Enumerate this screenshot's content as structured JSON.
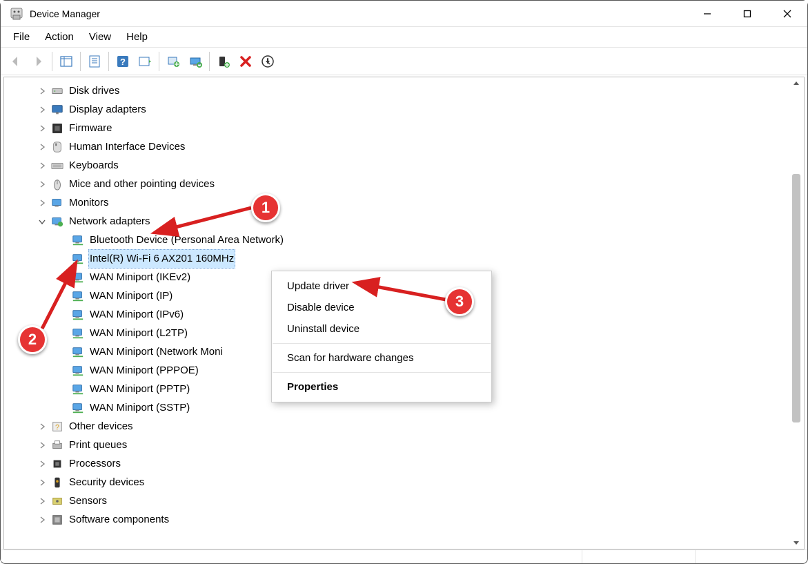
{
  "window": {
    "title": "Device Manager"
  },
  "menu": {
    "file": "File",
    "action": "Action",
    "view": "View",
    "help": "Help"
  },
  "tree": {
    "categories": [
      {
        "label": "Disk drives",
        "expanded": false,
        "iconType": "disk"
      },
      {
        "label": "Display adapters",
        "expanded": false,
        "iconType": "display"
      },
      {
        "label": "Firmware",
        "expanded": false,
        "iconType": "firmware"
      },
      {
        "label": "Human Interface Devices",
        "expanded": false,
        "iconType": "hid"
      },
      {
        "label": "Keyboards",
        "expanded": false,
        "iconType": "keyboard"
      },
      {
        "label": "Mice and other pointing devices",
        "expanded": false,
        "iconType": "mouse"
      },
      {
        "label": "Monitors",
        "expanded": false,
        "iconType": "monitor"
      },
      {
        "label": "Network adapters",
        "expanded": true,
        "iconType": "network",
        "children": [
          {
            "label": "Bluetooth Device (Personal Area Network)",
            "selected": false
          },
          {
            "label": "Intel(R) Wi-Fi 6 AX201 160MHz",
            "selected": true
          },
          {
            "label": "WAN Miniport (IKEv2)",
            "selected": false
          },
          {
            "label": "WAN Miniport (IP)",
            "selected": false
          },
          {
            "label": "WAN Miniport (IPv6)",
            "selected": false
          },
          {
            "label": "WAN Miniport (L2TP)",
            "selected": false
          },
          {
            "label": "WAN Miniport (Network Moni",
            "selected": false
          },
          {
            "label": "WAN Miniport (PPPOE)",
            "selected": false
          },
          {
            "label": "WAN Miniport (PPTP)",
            "selected": false
          },
          {
            "label": "WAN Miniport (SSTP)",
            "selected": false
          }
        ]
      },
      {
        "label": "Other devices",
        "expanded": false,
        "iconType": "other"
      },
      {
        "label": "Print queues",
        "expanded": false,
        "iconType": "printer"
      },
      {
        "label": "Processors",
        "expanded": false,
        "iconType": "cpu"
      },
      {
        "label": "Security devices",
        "expanded": false,
        "iconType": "security"
      },
      {
        "label": "Sensors",
        "expanded": false,
        "iconType": "sensor"
      },
      {
        "label": "Software components",
        "expanded": false,
        "iconType": "software"
      }
    ]
  },
  "context_menu": {
    "update": "Update driver",
    "disable": "Disable device",
    "uninstall": "Uninstall device",
    "scan": "Scan for hardware changes",
    "properties": "Properties"
  },
  "annotations": {
    "m1": "1",
    "m2": "2",
    "m3": "3"
  }
}
